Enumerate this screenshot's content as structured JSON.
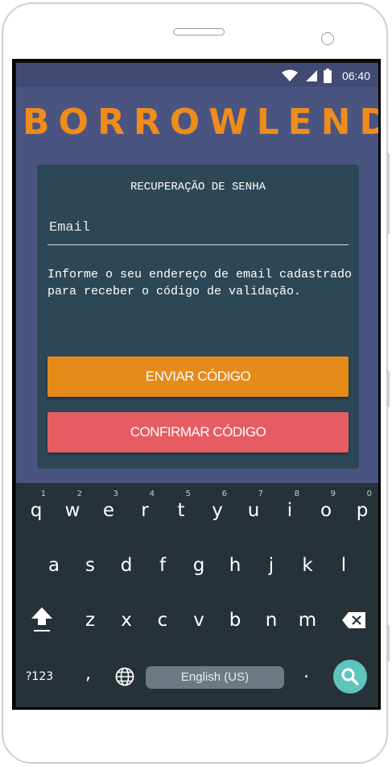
{
  "app": {
    "logo": "BORROWLEND"
  },
  "statusbar": {
    "time": "06:40",
    "icons": [
      "wifi-icon",
      "signal-icon",
      "battery-icon"
    ]
  },
  "card": {
    "title": "RECUPERAÇÃO DE SENHA",
    "email_placeholder": "Email",
    "email_value": "",
    "info_text": "Informe o seu endereço de email cadastrado para receber o código de validação.",
    "send_button": "ENVIAR CÓDIGO",
    "confirm_button": "CONFIRMAR CÓDIGO"
  },
  "keyboard": {
    "row1": [
      {
        "key": "q",
        "hint": "1"
      },
      {
        "key": "w",
        "hint": "2"
      },
      {
        "key": "e",
        "hint": "3"
      },
      {
        "key": "r",
        "hint": "4"
      },
      {
        "key": "t",
        "hint": "5"
      },
      {
        "key": "y",
        "hint": "6"
      },
      {
        "key": "u",
        "hint": "7"
      },
      {
        "key": "i",
        "hint": "8"
      },
      {
        "key": "o",
        "hint": "9"
      },
      {
        "key": "p",
        "hint": "0"
      }
    ],
    "row2": [
      "a",
      "s",
      "d",
      "f",
      "g",
      "h",
      "j",
      "k",
      "l"
    ],
    "row3": [
      "z",
      "x",
      "c",
      "v",
      "b",
      "n",
      "m"
    ],
    "symbols_key": "?123",
    "comma_key": ",",
    "space_label": "English (US)",
    "period_key": ".",
    "icons": [
      "shift-icon",
      "backspace-icon",
      "globe-icon",
      "search-icon"
    ]
  },
  "colors": {
    "background": "#4a5480",
    "statusbar": "#414a73",
    "logo": "#ee8c1c",
    "card": "#2c4756",
    "send_button": "#e68a1a",
    "confirm_button": "#e65c63",
    "keyboard": "#263238",
    "search_key": "#5fc4bb"
  }
}
